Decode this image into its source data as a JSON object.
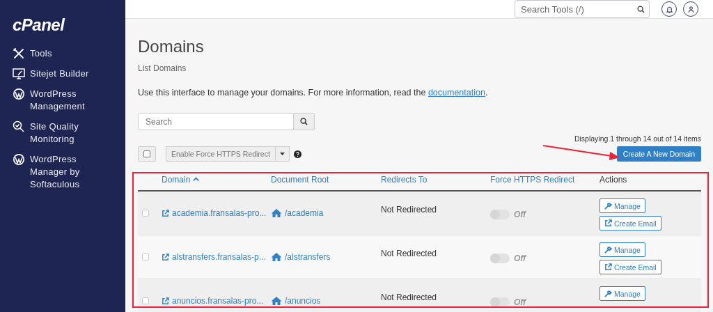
{
  "sidebar": {
    "logo": "cPanel",
    "items": [
      {
        "label": "Tools",
        "kind": "tools"
      },
      {
        "label": "Sitejet Builder",
        "kind": "monitor"
      },
      {
        "label": "WordPress Management",
        "kind": "wordpress"
      },
      {
        "label": "Site Quality Monitoring",
        "kind": "quality"
      },
      {
        "label": "WordPress Manager by Softaculous",
        "kind": "wordpress"
      }
    ]
  },
  "topbar": {
    "search": {
      "placeholder": "Search Tools (/)"
    }
  },
  "page": {
    "title": "Domains",
    "subtitle": "List Domains",
    "intro": "Use this interface to manage your domains. For more information, read the",
    "intro_link": "documentation",
    "intro_end": "."
  },
  "search": {
    "placeholder": "Search"
  },
  "toolbar": {
    "select_all_checked": false,
    "bulk_action": "Enable Force HTTPS Redirect",
    "count": "Displaying 1 through 14 out of 14 items",
    "create_button": "Create A New Domain"
  },
  "table": {
    "columns": [
      {
        "label": "Domain",
        "sortable": true,
        "sorted": true
      },
      {
        "label": "Document Root",
        "sortable": true,
        "sorted": false
      },
      {
        "label": "Redirects To",
        "sortable": true,
        "sorted": false
      },
      {
        "label": "Force HTTPS Redirect",
        "sortable": true,
        "sorted": false
      },
      {
        "label": "Actions",
        "sortable": false,
        "sorted": false
      }
    ],
    "rows": [
      {
        "checked": false,
        "domain": "academia.fransalas-pro...",
        "document_root": "/academia",
        "redirects_to": "Not Redirected",
        "https_on": false,
        "https_label": "Off",
        "actions": [
          "Manage",
          "Create Email"
        ]
      },
      {
        "checked": false,
        "domain": "alstransfers.fransalas-p...",
        "document_root": "/alstransfers",
        "redirects_to": "Not Redirected",
        "https_on": false,
        "https_label": "Off",
        "actions": [
          "Manage",
          "Create Email"
        ]
      },
      {
        "checked": false,
        "domain": "anuncios.fransalas-pro...",
        "document_root": "/anuncios",
        "redirects_to": "Not Redirected",
        "https_on": false,
        "https_label": "Off",
        "actions": [
          "Manage"
        ]
      }
    ]
  }
}
